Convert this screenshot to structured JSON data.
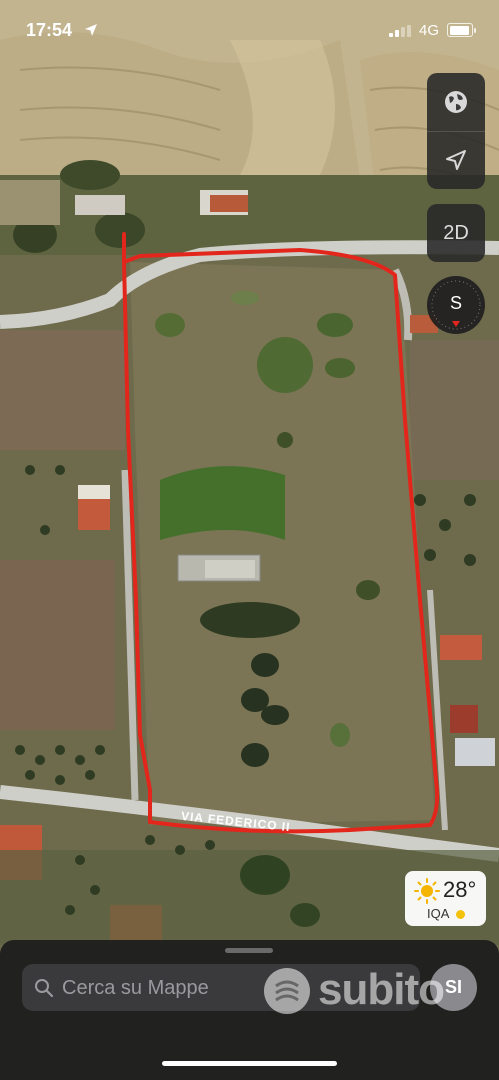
{
  "status_bar": {
    "time": "17:54",
    "network": "4G"
  },
  "map": {
    "street_label": "VIA FEDERICO II",
    "mode_button": "2D",
    "compass_heading": "S"
  },
  "weather": {
    "temperature": "28°",
    "aqi_label": "IQA"
  },
  "search": {
    "placeholder": "Cerca su Mappe"
  },
  "profile": {
    "initials": "SI"
  },
  "watermark": {
    "text": "subito"
  }
}
